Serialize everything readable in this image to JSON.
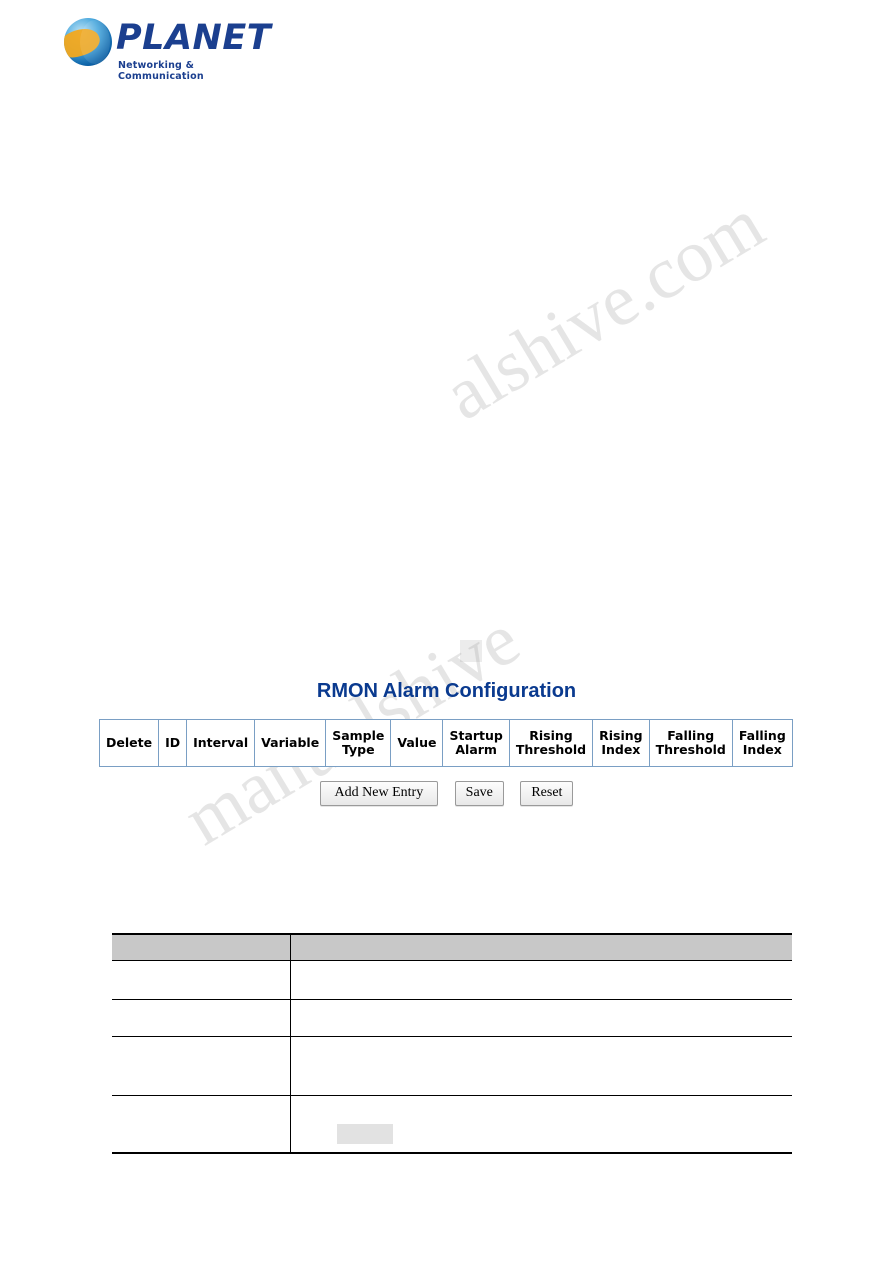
{
  "brand": {
    "name": "PLANET",
    "tagline": "Networking & Communication",
    "logo_icon": "globe-icon"
  },
  "watermark": {
    "line1": "alshive.com",
    "line2": "manualshive",
    "color": "#aaaaaa"
  },
  "screen": {
    "title": "RMON Alarm Configuration",
    "title_color": "#0a3a8f",
    "table": {
      "columns": [
        "Delete",
        "ID",
        "Interval",
        "Variable",
        "Sample\nType",
        "Value",
        "Startup\nAlarm",
        "Rising\nThreshold",
        "Rising\nIndex",
        "Falling\nThreshold",
        "Falling\nIndex"
      ],
      "rows": []
    },
    "buttons": {
      "add_new_entry": "Add New Entry",
      "save": "Save",
      "reset": "Reset"
    }
  },
  "description_table": {
    "header": {
      "col1": "",
      "col2": ""
    },
    "rows": [
      {
        "term": "",
        "definition": ""
      },
      {
        "term": "",
        "definition": ""
      },
      {
        "term": "",
        "definition": ""
      },
      {
        "term": "",
        "definition": ""
      }
    ]
  }
}
